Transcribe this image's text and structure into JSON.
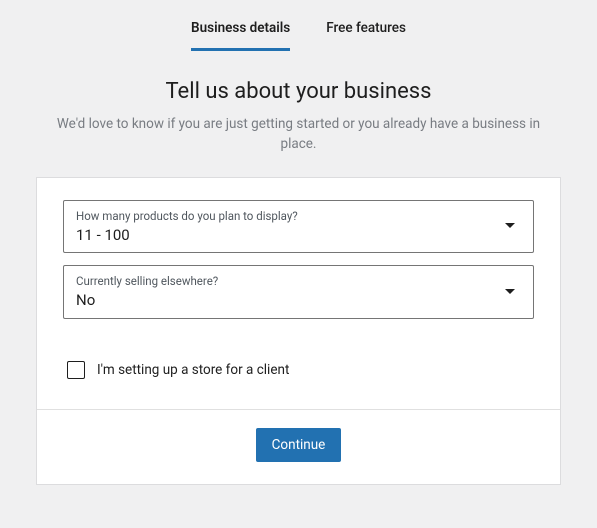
{
  "tabs": {
    "business_details": "Business details",
    "free_features": "Free features"
  },
  "heading": {
    "title": "Tell us about your business",
    "subtitle": "We'd love to know if you are just getting started or you already have a business in place."
  },
  "form": {
    "products": {
      "label": "How many products do you plan to display?",
      "value": "11 - 100"
    },
    "selling": {
      "label": "Currently selling elsewhere?",
      "value": "No"
    },
    "client_checkbox_label": "I'm setting up a store for a client"
  },
  "actions": {
    "continue": "Continue"
  }
}
